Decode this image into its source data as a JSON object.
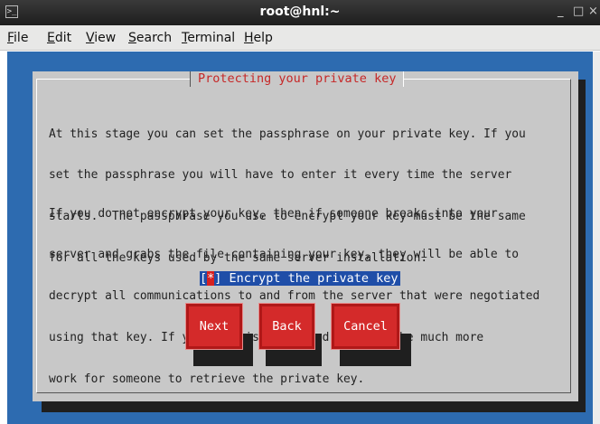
{
  "window": {
    "title": "root@hnl:~",
    "minimize": "_",
    "maximize": "□",
    "close": "×",
    "app_icon": "terminal-icon",
    "app_icon_glyph": ">_"
  },
  "menubar": {
    "items": [
      {
        "pre": "",
        "acc": "F",
        "post": "ile"
      },
      {
        "pre": "",
        "acc": "E",
        "post": "dit"
      },
      {
        "pre": "",
        "acc": "V",
        "post": "iew"
      },
      {
        "pre": "",
        "acc": "S",
        "post": "earch"
      },
      {
        "pre": "",
        "acc": "T",
        "post": "erminal"
      },
      {
        "pre": "",
        "acc": "H",
        "post": "elp"
      }
    ]
  },
  "dialog": {
    "title": "Protecting your private key",
    "paragraph1": [
      "At this stage you can set the passphrase on your private key. If you",
      "set the passphrase you will have to enter it every time the server",
      "starts.  The passphrase you use to encrypt your key must be the same",
      "for all the keys used by the same server installation."
    ],
    "paragraph2": [
      "If you do not encrypt your key, then if someone breaks into your",
      "server and grabs the file containing your key, they will be able to",
      "decrypt all communications to and from the server that were negotiated",
      "using that key. If your key is encrypted it would be much more",
      "work for someone to retrieve the private key."
    ],
    "checkbox": {
      "open": "[",
      "mark": "*",
      "close": "]",
      "label": " Encrypt the private key",
      "checked": true
    },
    "buttons": {
      "next": "Next",
      "back": "Back",
      "cancel": "Cancel"
    }
  },
  "colors": {
    "terminal_bg": "#2d6bb0",
    "dialog_bg": "#c8c8c8",
    "title_text": "#c62828",
    "button_bg": "#d42a2a",
    "checkbox_highlight": "#1f4ea8"
  }
}
